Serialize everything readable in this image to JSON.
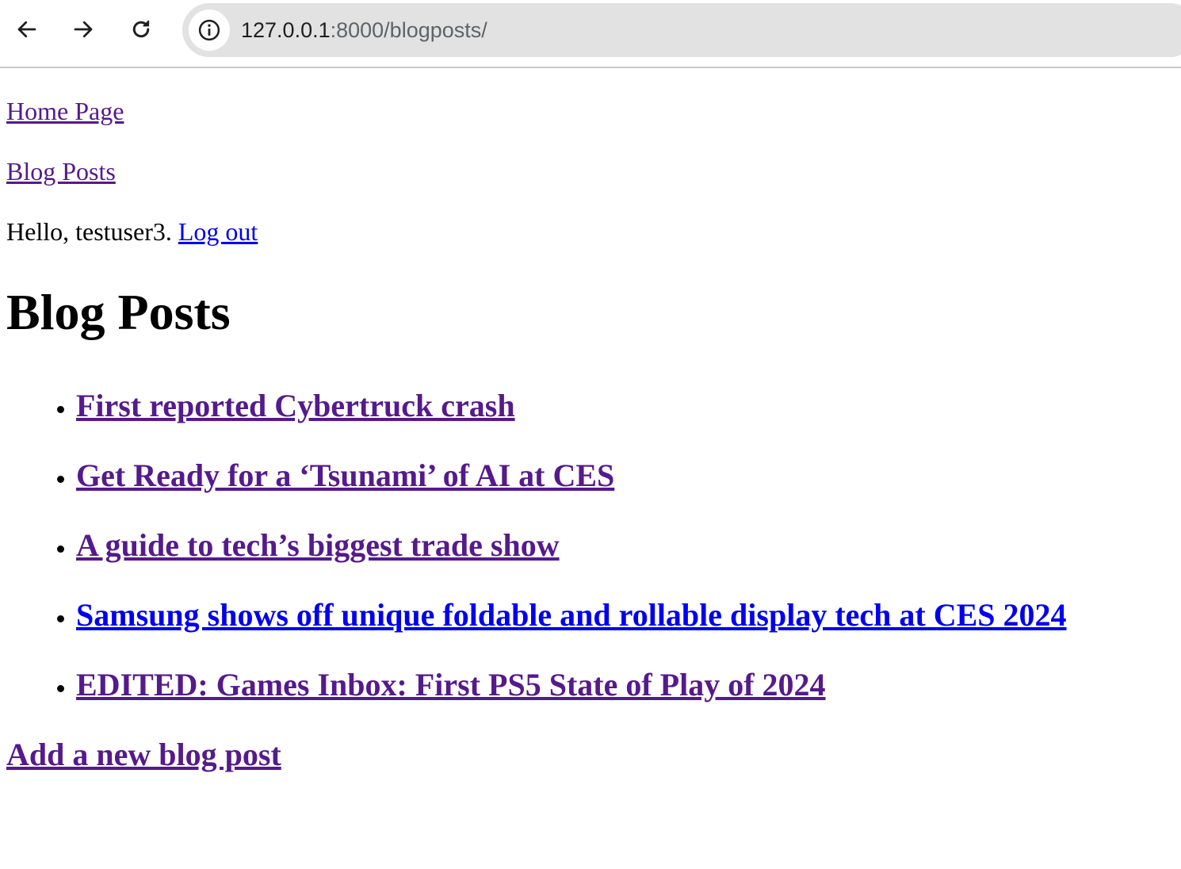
{
  "browser": {
    "back_icon": "arrow-left-icon",
    "forward_icon": "arrow-right-icon",
    "reload_icon": "reload-icon",
    "site_info_icon": "info-circle-icon",
    "url_host": "127.0.0.1",
    "url_rest": ":8000/blogposts/"
  },
  "nav": {
    "home_label": "Home Page",
    "blog_label": "Blog Posts"
  },
  "greeting": {
    "text": "Hello, testuser3.",
    "logout_label": "Log out"
  },
  "main": {
    "heading": "Blog Posts",
    "posts": [
      {
        "title": "First reported Cybertruck crash",
        "visited": true
      },
      {
        "title": "Get Ready for a ‘Tsunami’ of AI at CES",
        "visited": true
      },
      {
        "title": "A guide to tech’s biggest trade show",
        "visited": true
      },
      {
        "title": "Samsung shows off unique foldable and rollable display tech at CES 2024",
        "visited": false
      },
      {
        "title": "EDITED: Games Inbox: First PS5 State of Play of 2024",
        "visited": true
      }
    ],
    "add_post_label": "Add a new blog post"
  },
  "colors": {
    "visited_link": "#551a8b",
    "unvisited_link": "#0000ee",
    "omnibox_bg": "#e2e2e2"
  }
}
